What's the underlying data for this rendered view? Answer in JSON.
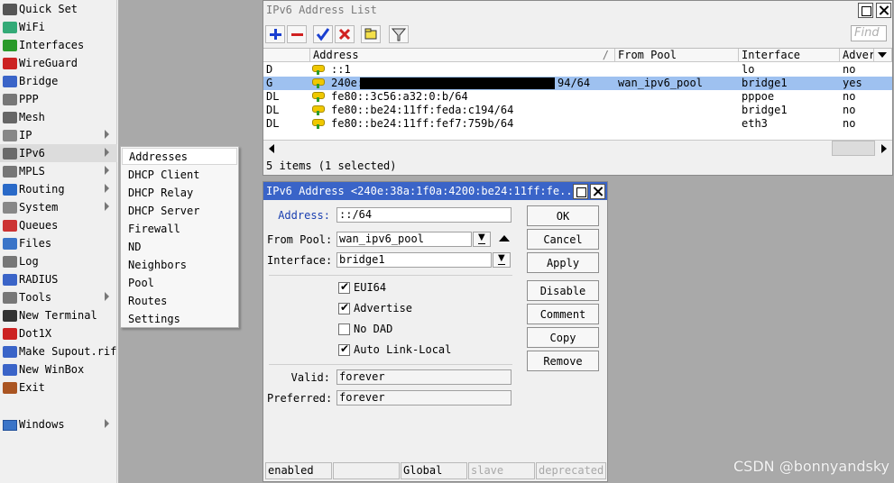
{
  "menu": {
    "items": [
      {
        "label": "Quick Set",
        "icon": "quick-set-icon"
      },
      {
        "label": "WiFi",
        "icon": "wifi-icon"
      },
      {
        "label": "Interfaces",
        "icon": "interfaces-icon"
      },
      {
        "label": "WireGuard",
        "icon": "wireguard-icon"
      },
      {
        "label": "Bridge",
        "icon": "bridge-icon"
      },
      {
        "label": "PPP",
        "icon": "ppp-icon"
      },
      {
        "label": "Mesh",
        "icon": "mesh-icon"
      },
      {
        "label": "IP",
        "icon": "ip-icon",
        "submenu": true
      },
      {
        "label": "IPv6",
        "icon": "ipv6-icon",
        "submenu": true,
        "selected": true
      },
      {
        "label": "MPLS",
        "icon": "mpls-icon",
        "submenu": true
      },
      {
        "label": "Routing",
        "icon": "routing-icon",
        "submenu": true
      },
      {
        "label": "System",
        "icon": "system-icon",
        "submenu": true
      },
      {
        "label": "Queues",
        "icon": "queues-icon"
      },
      {
        "label": "Files",
        "icon": "files-icon"
      },
      {
        "label": "Log",
        "icon": "log-icon"
      },
      {
        "label": "RADIUS",
        "icon": "radius-icon"
      },
      {
        "label": "Tools",
        "icon": "tools-icon",
        "submenu": true
      },
      {
        "label": "New Terminal",
        "icon": "terminal-icon"
      },
      {
        "label": "Dot1X",
        "icon": "dot1x-icon"
      },
      {
        "label": "Make Supout.rif",
        "icon": "supout-icon"
      },
      {
        "label": "New WinBox",
        "icon": "winbox-icon"
      },
      {
        "label": "Exit",
        "icon": "exit-icon"
      }
    ],
    "windows_item": {
      "label": "Windows",
      "icon": "windows-icon"
    }
  },
  "submenu": {
    "items": [
      "Addresses",
      "DHCP Client",
      "DHCP Relay",
      "DHCP Server",
      "Firewall",
      "ND",
      "Neighbors",
      "Pool",
      "Routes",
      "Settings"
    ],
    "highlighted": "Addresses"
  },
  "list_window": {
    "title": "IPv6 Address List",
    "find_placeholder": "Find",
    "toolbar": [
      "add-icon",
      "remove-icon",
      "enable-icon",
      "disable-icon",
      "comment-icon",
      "filter-icon"
    ],
    "columns": [
      "Address",
      "From Pool",
      "Interface",
      "Adver"
    ],
    "rows": [
      {
        "flag": "D",
        "address": "::1",
        "pool": "",
        "iface": "lo",
        "adv": "no",
        "selected": false,
        "redacted": false
      },
      {
        "flag": "G",
        "address": "240e:",
        "address_tail": "94/64",
        "pool": "wan_ipv6_pool",
        "iface": "bridge1",
        "adv": "yes",
        "selected": true,
        "redacted": true
      },
      {
        "flag": "DL",
        "address": "fe80::3c56:a32:0:b/64",
        "pool": "",
        "iface": "pppoe",
        "adv": "no",
        "selected": false,
        "redacted": false
      },
      {
        "flag": "DL",
        "address": "fe80::be24:11ff:feda:c194/64",
        "pool": "",
        "iface": "bridge1",
        "adv": "no",
        "selected": false,
        "redacted": false
      },
      {
        "flag": "DL",
        "address": "fe80::be24:11ff:fef7:759b/64",
        "pool": "",
        "iface": "eth3",
        "adv": "no",
        "selected": false,
        "redacted": false
      }
    ],
    "status": "5 items (1 selected)"
  },
  "address_window": {
    "title": "IPv6 Address <240e:38a:1f0a:4200:be24:11ff:fe...",
    "labels": {
      "address": "Address:",
      "from_pool": "From Pool:",
      "interface": "Interface:",
      "valid": "Valid:",
      "preferred": "Preferred:"
    },
    "values": {
      "address": "::/64",
      "from_pool": "wan_ipv6_pool",
      "interface": "bridge1",
      "valid": "forever",
      "preferred": "forever"
    },
    "checkboxes": [
      {
        "label": "EUI64",
        "checked": true
      },
      {
        "label": "Advertise",
        "checked": true
      },
      {
        "label": "No DAD",
        "checked": false
      },
      {
        "label": "Auto Link-Local",
        "checked": true
      }
    ],
    "buttons": [
      "OK",
      "Cancel",
      "Apply",
      "Disable",
      "Comment",
      "Copy",
      "Remove"
    ],
    "status": [
      "enabled",
      "",
      "Global",
      "slave",
      "deprecated"
    ]
  },
  "watermark": "CSDN @bonnyandsky",
  "colors": {
    "titlebar": "#3a64c8",
    "selected_row": "#9ec1f0",
    "desktop": "#a9a9a9"
  }
}
